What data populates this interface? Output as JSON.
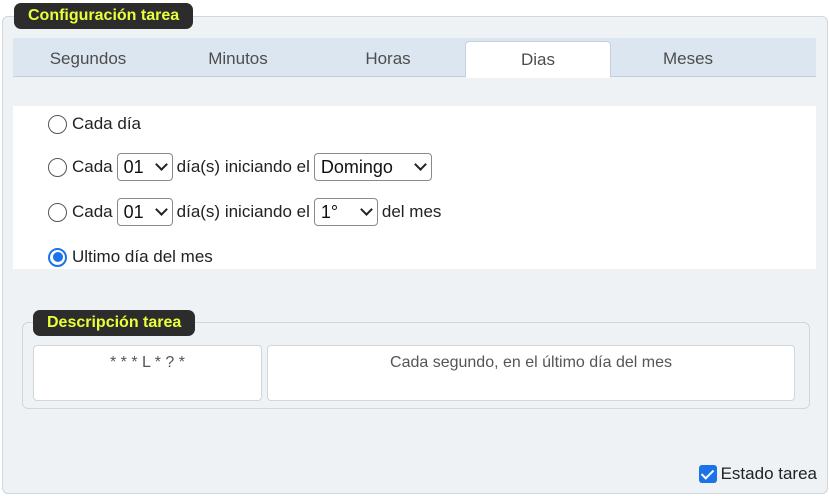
{
  "panel": {
    "legend": "Configuración tarea"
  },
  "tabs": [
    {
      "label": "Segundos"
    },
    {
      "label": "Minutos"
    },
    {
      "label": "Horas"
    },
    {
      "label": "Dias",
      "active": true
    },
    {
      "label": "Meses"
    }
  ],
  "options": {
    "every_day": {
      "label": "Cada día",
      "selected": false
    },
    "every_n_days_weekday": {
      "prefix": "Cada",
      "count": "01",
      "middle": "día(s) iniciando el",
      "weekday": "Domingo",
      "selected": false
    },
    "every_n_days_monthday": {
      "prefix": "Cada",
      "count": "01",
      "middle": "día(s) iniciando el",
      "day": "1°",
      "suffix": "del mes",
      "selected": false
    },
    "last_day": {
      "label": "Ultimo día del mes",
      "selected": true
    }
  },
  "description": {
    "legend": "Descripción tarea",
    "expression": "* * * L * ? *",
    "text": "Cada segundo, en el último día del mes"
  },
  "estado": {
    "label": "Estado tarea",
    "checked": true
  },
  "colors": {
    "accent": "#1a73e8",
    "legend_bg": "#2c2c2c",
    "legend_text": "#eaff3a",
    "tab_bar": "#dce6f1"
  }
}
